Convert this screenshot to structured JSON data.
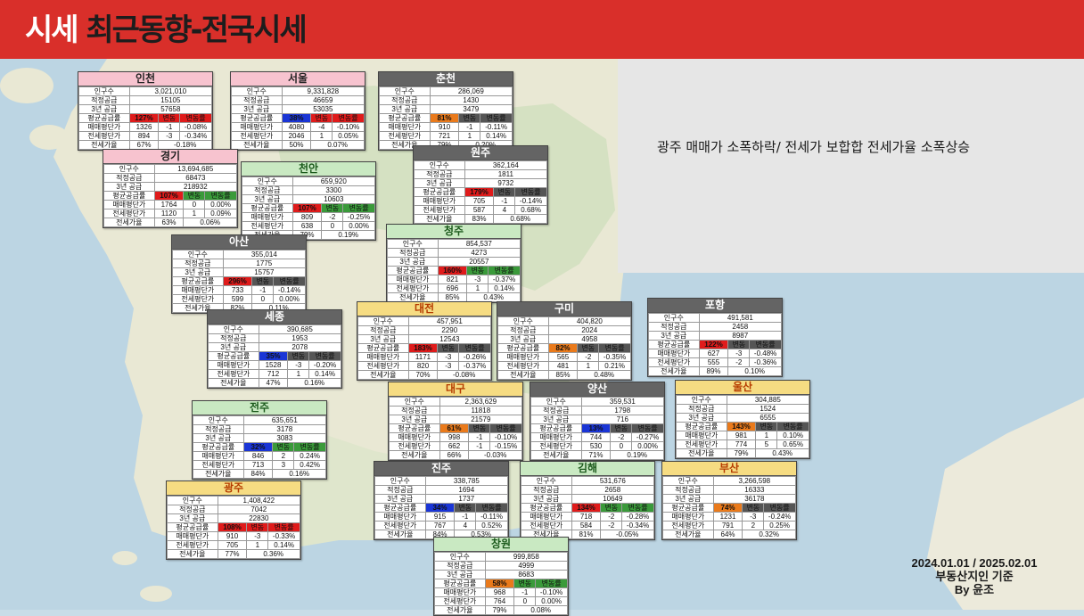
{
  "header": {
    "title_white": "시세",
    "title_dark": "최근동향-전국시세"
  },
  "note": "광주 매매가 소폭하락/ 전세가 보합합 전세가율 소폭상승",
  "footer": {
    "line1": "2024.01.01 / 2025.02.01",
    "line2": "부동산지인 기준",
    "line3": "By 윤조"
  },
  "labels": {
    "pop": "인구수",
    "supply": "적정공급",
    "supply3": "3년 공급",
    "avg": "평균공급률",
    "change": "변동",
    "changerate": "변동률",
    "sale": "매매평단가",
    "jeonse": "전세평단가",
    "ratio": "전세가율"
  },
  "colors": {
    "banner": "#d92f2a",
    "red": "#e01b1b",
    "orange": "#ea7a1b",
    "blue": "#1a35d6"
  },
  "regions": [
    {
      "name": "인천",
      "pop": "3,021,010",
      "supply": "15105",
      "supply3": "57658",
      "avg": "127%",
      "sale": [
        "1326",
        "-1",
        "-0.08%"
      ],
      "jeonse": [
        "894",
        "-3",
        "-0.34%"
      ],
      "ratio": [
        "67%",
        "-0.18%"
      ]
    },
    {
      "name": "서울",
      "pop": "9,331,828",
      "supply": "46659",
      "supply3": "53035",
      "avg": "38%",
      "sale": [
        "4080",
        "-4",
        "-0.10%"
      ],
      "jeonse": [
        "2046",
        "1",
        "0.05%"
      ],
      "ratio": [
        "50%",
        "0.07%"
      ]
    },
    {
      "name": "춘천",
      "pop": "286,069",
      "supply": "1430",
      "supply3": "3479",
      "avg": "81%",
      "sale": [
        "910",
        "-1",
        "-0.11%"
      ],
      "jeonse": [
        "721",
        "1",
        "0.14%"
      ],
      "ratio": [
        "79%",
        "0.20%"
      ]
    },
    {
      "name": "경기",
      "pop": "13,694,685",
      "supply": "68473",
      "supply3": "218932",
      "avg": "107%",
      "sale": [
        "1764",
        "0",
        "0.00%"
      ],
      "jeonse": [
        "1120",
        "1",
        "0.09%"
      ],
      "ratio": [
        "63%",
        "0.06%"
      ]
    },
    {
      "name": "천안",
      "pop": "659,920",
      "supply": "3300",
      "supply3": "10603",
      "avg": "107%",
      "sale": [
        "809",
        "-2",
        "-0.25%"
      ],
      "jeonse": [
        "638",
        "0",
        "0.00%"
      ],
      "ratio": [
        "79%",
        "0.19%"
      ]
    },
    {
      "name": "원주",
      "pop": "362,164",
      "supply": "1811",
      "supply3": "9732",
      "avg": "179%",
      "sale": [
        "705",
        "-1",
        "-0.14%"
      ],
      "jeonse": [
        "587",
        "4",
        "0.68%"
      ],
      "ratio": [
        "83%",
        "0.68%"
      ]
    },
    {
      "name": "아산",
      "pop": "355,014",
      "supply": "1775",
      "supply3": "15757",
      "avg": "296%",
      "sale": [
        "733",
        "-1",
        "-0.14%"
      ],
      "jeonse": [
        "599",
        "0",
        "0.00%"
      ],
      "ratio": [
        "82%",
        "0.11%"
      ]
    },
    {
      "name": "청주",
      "pop": "854,537",
      "supply": "4273",
      "supply3": "20557",
      "avg": "160%",
      "sale": [
        "821",
        "-3",
        "-0.37%"
      ],
      "jeonse": [
        "696",
        "1",
        "0.14%"
      ],
      "ratio": [
        "85%",
        "0.43%"
      ]
    },
    {
      "name": "세종",
      "pop": "390,685",
      "supply": "1953",
      "supply3": "2078",
      "avg": "35%",
      "sale": [
        "1528",
        "-3",
        "-0.20%"
      ],
      "jeonse": [
        "712",
        "1",
        "0.14%"
      ],
      "ratio": [
        "47%",
        "0.16%"
      ]
    },
    {
      "name": "대전",
      "pop": "457,951",
      "supply": "2290",
      "supply3": "12543",
      "avg": "183%",
      "sale": [
        "1171",
        "-3",
        "-0.26%"
      ],
      "jeonse": [
        "820",
        "-3",
        "-0.37%"
      ],
      "ratio": [
        "70%",
        "-0.08%"
      ]
    },
    {
      "name": "구미",
      "pop": "404,820",
      "supply": "2024",
      "supply3": "4958",
      "avg": "82%",
      "sale": [
        "565",
        "-2",
        "-0.35%"
      ],
      "jeonse": [
        "481",
        "1",
        "0.21%"
      ],
      "ratio": [
        "85%",
        "0.48%"
      ]
    },
    {
      "name": "포항",
      "pop": "491,581",
      "supply": "2458",
      "supply3": "8987",
      "avg": "122%",
      "sale": [
        "627",
        "-3",
        "-0.48%"
      ],
      "jeonse": [
        "555",
        "-2",
        "-0.36%"
      ],
      "ratio": [
        "89%",
        "0.10%"
      ]
    },
    {
      "name": "전주",
      "pop": "635,651",
      "supply": "3178",
      "supply3": "3083",
      "avg": "32%",
      "sale": [
        "846",
        "2",
        "0.24%"
      ],
      "jeonse": [
        "713",
        "3",
        "0.42%"
      ],
      "ratio": [
        "84%",
        "0.16%"
      ]
    },
    {
      "name": "대구",
      "pop": "2,363,629",
      "supply": "11818",
      "supply3": "21579",
      "avg": "61%",
      "sale": [
        "998",
        "-1",
        "-0.10%"
      ],
      "jeonse": [
        "662",
        "-1",
        "-0.15%"
      ],
      "ratio": [
        "66%",
        "-0.03%"
      ]
    },
    {
      "name": "양산",
      "pop": "359,531",
      "supply": "1798",
      "supply3": "716",
      "avg": "13%",
      "sale": [
        "744",
        "-2",
        "-0.27%"
      ],
      "jeonse": [
        "530",
        "0",
        "0.00%"
      ],
      "ratio": [
        "71%",
        "0.19%"
      ]
    },
    {
      "name": "울산",
      "pop": "304,885",
      "supply": "1524",
      "supply3": "6555",
      "avg": "143%",
      "sale": [
        "981",
        "1",
        "0.10%"
      ],
      "jeonse": [
        "774",
        "5",
        "0.65%"
      ],
      "ratio": [
        "79%",
        "0.43%"
      ]
    },
    {
      "name": "광주",
      "pop": "1,408,422",
      "supply": "7042",
      "supply3": "22830",
      "avg": "108%",
      "sale": [
        "910",
        "-3",
        "-0.33%"
      ],
      "jeonse": [
        "705",
        "1",
        "0.14%"
      ],
      "ratio": [
        "77%",
        "0.36%"
      ]
    },
    {
      "name": "진주",
      "pop": "338,785",
      "supply": "1694",
      "supply3": "1737",
      "avg": "34%",
      "sale": [
        "915",
        "-1",
        "-0.11%"
      ],
      "jeonse": [
        "767",
        "4",
        "0.52%"
      ],
      "ratio": [
        "84%",
        "0.53%"
      ]
    },
    {
      "name": "김해",
      "pop": "531,676",
      "supply": "2658",
      "supply3": "10649",
      "avg": "134%",
      "sale": [
        "718",
        "-2",
        "-0.28%"
      ],
      "jeonse": [
        "584",
        "-2",
        "-0.34%"
      ],
      "ratio": [
        "81%",
        "-0.05%"
      ]
    },
    {
      "name": "부산",
      "pop": "3,266,598",
      "supply": "16333",
      "supply3": "36178",
      "avg": "74%",
      "sale": [
        "1231",
        "-3",
        "-0.24%"
      ],
      "jeonse": [
        "791",
        "2",
        "0.25%"
      ],
      "ratio": [
        "64%",
        "0.32%"
      ]
    },
    {
      "name": "창원",
      "pop": "999,858",
      "supply": "4999",
      "supply3": "8683",
      "avg": "58%",
      "sale": [
        "968",
        "-1",
        "-0.10%"
      ],
      "jeonse": [
        "764",
        "0",
        "0.00%"
      ],
      "ratio": [
        "79%",
        "0.08%"
      ]
    }
  ]
}
